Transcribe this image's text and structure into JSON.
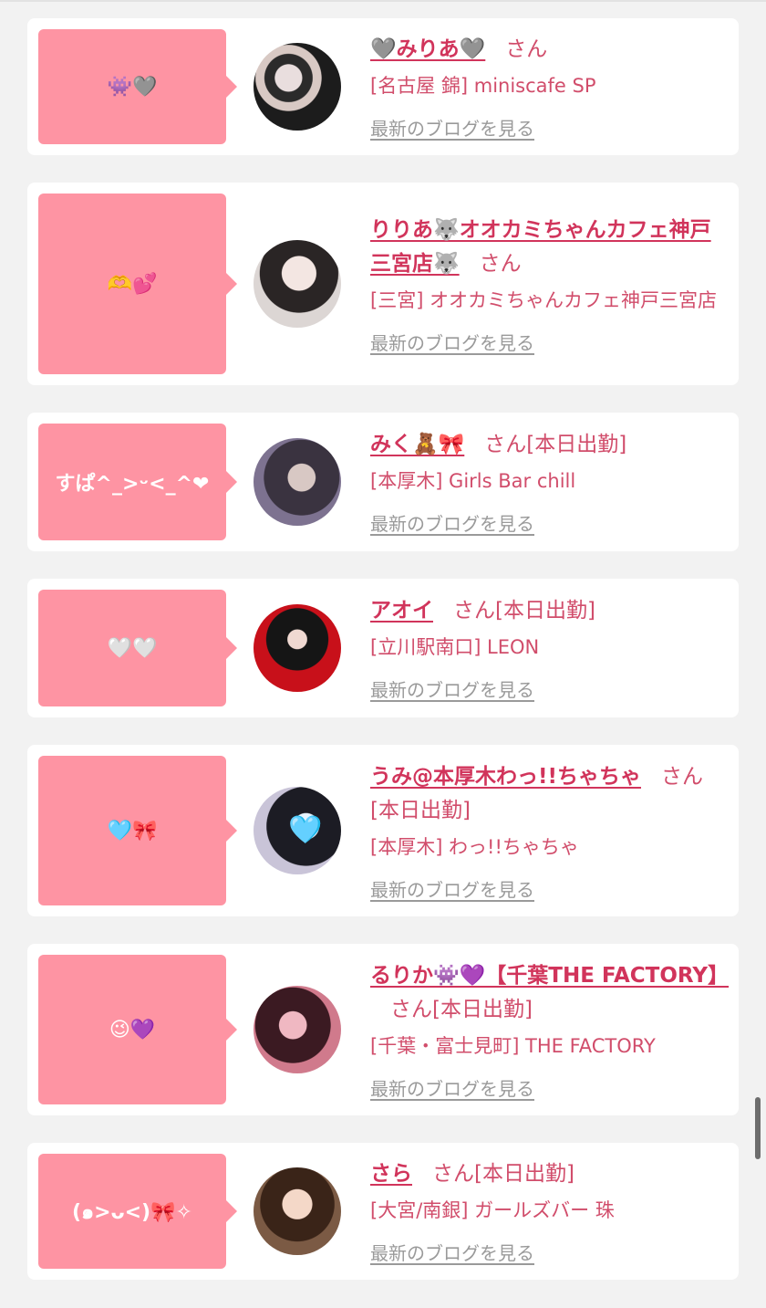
{
  "cards": [
    {
      "message": "👾🩶",
      "name": "🩶みりあ🩶",
      "san": "さん",
      "status": "",
      "shop": "[名古屋 錦] miniscafe SP",
      "blog": "最新のブログを見る"
    },
    {
      "message": "🫶💕",
      "name": "りりあ🐺オオカミちゃんカフェ神戸三宮店🐺",
      "san": "さん",
      "status": "",
      "shop": "[三宮] オオカミちゃんカフェ神戸三宮店",
      "blog": "最新のブログを見る"
    },
    {
      "message": "すぱ^_>ᵕ<_^❤",
      "name": "みく🧸🎀",
      "san": "さん",
      "status": "[本日出勤]",
      "shop": "[本厚木] Girls Bar chill",
      "blog": "最新のブログを見る"
    },
    {
      "message": "🤍🤍",
      "name": "アオイ",
      "san": "さん",
      "status": "[本日出勤]",
      "shop": "[立川駅南口] LEON",
      "blog": "最新のブログを見る"
    },
    {
      "message": "🩵🎀",
      "name": "うみ@本厚木わっ!!ちゃちゃ",
      "san": "さん",
      "status": "[本日出勤]",
      "shop": "[本厚木] わっ!!ちゃちゃ",
      "blog": "最新のブログを見る"
    },
    {
      "message": "😉💜",
      "name": "るりか👾💜【千葉THE FACTORY】",
      "san": "さん",
      "status": "[本日出勤]",
      "shop": "[千葉・富士見町] THE FACTORY",
      "blog": "最新のブログを見る"
    },
    {
      "message": "(๑>ᴗ<)🎀✧",
      "name": "さら",
      "san": "さん",
      "status": "[本日出勤]",
      "shop": "[大宮/南銀] ガールズバー 珠",
      "blog": "最新のブログを見る"
    }
  ],
  "colors": {
    "bubble": "#fe94a3",
    "name": "#d1345b",
    "text": "#d14d6b",
    "link": "#9a9a9a",
    "background": "#f2f2f2"
  },
  "overlay_icon": "🩵"
}
